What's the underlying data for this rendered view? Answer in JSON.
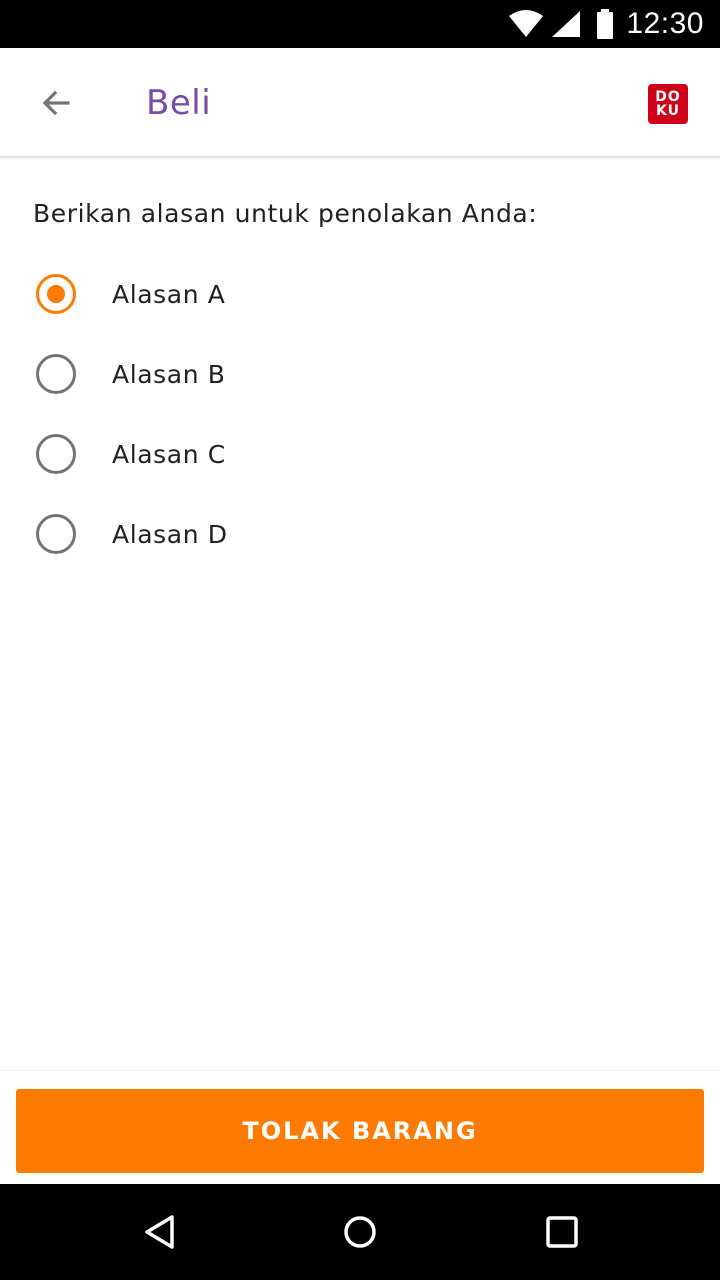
{
  "status_bar": {
    "time": "12:30",
    "icons": [
      "wifi-icon",
      "signal-icon",
      "battery-icon"
    ]
  },
  "app_bar": {
    "title": "Beli",
    "back_icon": "arrow-left-icon",
    "logo_text_top": "DO",
    "logo_text_bottom": "KU"
  },
  "form": {
    "prompt": "Berikan alasan untuk penolakan Anda:",
    "options": [
      {
        "label": "Alasan A",
        "selected": true
      },
      {
        "label": "Alasan B",
        "selected": false
      },
      {
        "label": "Alasan C",
        "selected": false
      },
      {
        "label": "Alasan D",
        "selected": false
      }
    ]
  },
  "actions": {
    "submit_label": "TOLAK BARANG"
  },
  "colors": {
    "accent": "#ff7a00",
    "title": "#7b4aa8",
    "logo": "#d0021b"
  },
  "nav_bar": {
    "icons": [
      "nav-back-icon",
      "nav-home-icon",
      "nav-recents-icon"
    ]
  }
}
